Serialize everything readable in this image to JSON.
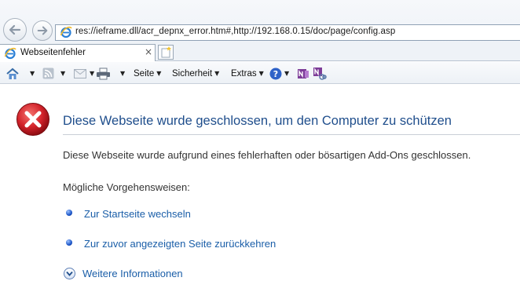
{
  "browser": {
    "address": "res://ieframe.dll/acr_depnx_error.htm#,http://192.168.0.15/doc/page/config.asp",
    "tab": {
      "title": "Webseitenfehler",
      "close_glyph": "×"
    }
  },
  "command_bar": {
    "page_label": "Seite",
    "safety_label": "Sicherheit",
    "extras_label": "Extras"
  },
  "content": {
    "heading": "Diese Webseite wurde geschlossen, um den Computer zu schützen",
    "description": "Diese Webseite wurde aufgrund eines fehlerhaften oder bösartigen Add-Ons geschlossen.",
    "options_heading": "Mögliche Vorgehensweisen:",
    "links": {
      "home": "Zur Startseite wechseln",
      "back": "Zur zuvor angezeigten Seite zurückkehren",
      "more": "Weitere Informationen"
    }
  },
  "icons": [
    "back-arrow-icon",
    "forward-arrow-icon",
    "ie-logo-icon",
    "new-tab-icon",
    "home-icon",
    "rss-feed-icon",
    "mail-icon",
    "print-icon",
    "help-icon",
    "onenote-icon",
    "onenote-linked-icon",
    "error-x-icon",
    "expand-chevron-icon"
  ],
  "colors": {
    "heading": "#1f4e8c",
    "link": "#1a5ea8",
    "error_red": "#d3232b"
  }
}
